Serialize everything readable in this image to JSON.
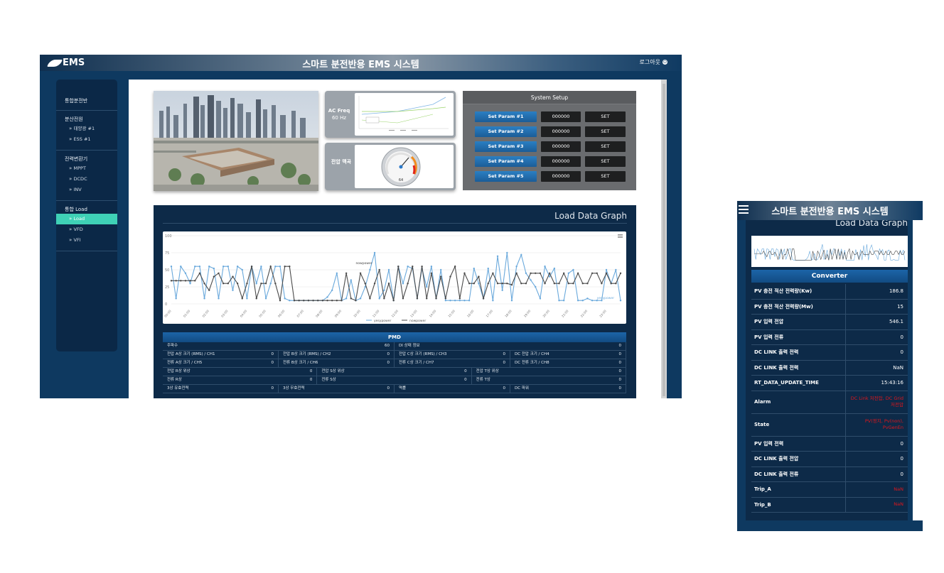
{
  "desktop": {
    "logo": "EMS",
    "title": "스마트 분전반용 EMS 시스템",
    "logout": "로그아웃",
    "sidebar": [
      {
        "head": "통합분전반",
        "items": []
      },
      {
        "head": "분산전원",
        "items": [
          "태양광 #1",
          "ESS #1"
        ]
      },
      {
        "head": "전력변환기",
        "items": [
          "MPPT",
          "DCDC",
          "INV"
        ]
      },
      {
        "head": "통합 Load",
        "items": [
          "Load",
          "VFD",
          "VFI"
        ]
      }
    ],
    "ac_freq": {
      "label": "AC Freq",
      "value": "60 Hz"
    },
    "gauge": {
      "label": "전압 맥곡",
      "value": "64"
    },
    "setup": {
      "title": "System Setup",
      "rows": [
        {
          "param": "Set Param #1",
          "value": "000000",
          "button": "SET"
        },
        {
          "param": "Set Param #2",
          "value": "000000",
          "button": "SET"
        },
        {
          "param": "Set Param #3",
          "value": "000000",
          "button": "SET"
        },
        {
          "param": "Set Param #4",
          "value": "000000",
          "button": "SET"
        },
        {
          "param": "Set Param #5",
          "value": "000000",
          "button": "SET"
        }
      ]
    },
    "graph_title": "Load Data Graph",
    "pmd": {
      "title": "PMD",
      "rows": [
        [
          [
            "주파수",
            "60"
          ],
          [
            "DI 상태 정보",
            "0"
          ]
        ],
        [
          [
            "전압 A상 크기 (RMS) / CH1",
            "0"
          ],
          [
            "전압 B상 크기 (RMS) / CH2",
            "0"
          ],
          [
            "전압 C상 크기 (RMS) / CH3",
            "0"
          ],
          [
            "DC 전압 크기 / CH4",
            "0"
          ]
        ],
        [
          [
            "전류 A상 크기 / CH5",
            "0"
          ],
          [
            "전류 B상 크기 / CH6",
            "0"
          ],
          [
            "전류 C상 크기 / CH7",
            "0"
          ],
          [
            "DC 전류 크기 / CH8",
            "0"
          ]
        ],
        [
          [
            "전압 R상 위상",
            "0"
          ],
          [
            "전압 S상 위상",
            "0"
          ],
          [
            "전압 T상 위상",
            "0"
          ]
        ],
        [
          [
            "전류 R상",
            "0"
          ],
          [
            "전류 S상",
            "0"
          ],
          [
            "전류 T상",
            "0"
          ]
        ],
        [
          [
            "3상 유효전력",
            "0"
          ],
          [
            "3상 무효전력",
            "0"
          ],
          [
            "역률",
            "0"
          ],
          [
            "DC 파워",
            "0"
          ]
        ]
      ]
    }
  },
  "chart_data": {
    "type": "line",
    "ylim": [
      0,
      100
    ],
    "yticks": [
      0,
      25,
      50,
      75,
      100
    ],
    "x": [
      "00:00",
      "00:15",
      "00:30",
      "00:45",
      "01:00",
      "01:15",
      "01:30",
      "01:45",
      "02:00",
      "02:15",
      "02:30",
      "02:45",
      "03:00",
      "03:15",
      "03:30",
      "03:45",
      "04:00",
      "04:15",
      "04:30",
      "04:45",
      "05:00",
      "05:15",
      "05:30",
      "05:45",
      "06:00",
      "06:15",
      "06:30",
      "06:45",
      "07:00",
      "07:15",
      "07:30",
      "07:45",
      "08:00",
      "08:15",
      "08:30",
      "08:45",
      "09:00",
      "09:15",
      "09:30",
      "09:45",
      "10:00",
      "10:15",
      "10:30",
      "10:45",
      "11:00",
      "11:15",
      "11:30",
      "11:45",
      "12:00",
      "12:15",
      "12:30",
      "12:45",
      "13:00",
      "13:15",
      "13:30",
      "13:45",
      "14:00",
      "14:15",
      "14:30",
      "14:45",
      "15:00",
      "15:15",
      "15:30",
      "15:45",
      "16:00",
      "16:15",
      "16:30",
      "16:45",
      "17:00",
      "17:15",
      "17:30",
      "17:45",
      "18:00",
      "18:15",
      "18:30",
      "18:45",
      "19:00",
      "19:15",
      "19:30",
      "19:45",
      "20:00",
      "20:15",
      "20:30",
      "20:45",
      "21:00",
      "21:15",
      "21:30",
      "21:45",
      "22:00",
      "22:15",
      "22:30",
      "22:45",
      "23:00",
      "23:15",
      "23:30",
      "23:45"
    ],
    "xticks_every": 4,
    "series": [
      {
        "name": "yesypower",
        "color": "#6aa9dc",
        "values": [
          55,
          8,
          55,
          45,
          30,
          55,
          55,
          8,
          55,
          52,
          8,
          55,
          55,
          20,
          55,
          50,
          8,
          55,
          30,
          55,
          8,
          30,
          55,
          55,
          8,
          5,
          5,
          5,
          5,
          5,
          5,
          5,
          5,
          10,
          20,
          45,
          5,
          8,
          35,
          5,
          8,
          25,
          50,
          75,
          8,
          20,
          50,
          5,
          55,
          30,
          55,
          52,
          8,
          52,
          25,
          55,
          8,
          50,
          5,
          5,
          5,
          5,
          5,
          5,
          52,
          30,
          8,
          52,
          5,
          70,
          20,
          75,
          5,
          55,
          72,
          45,
          35,
          25,
          8,
          55,
          40,
          52,
          5,
          5,
          45,
          50,
          5,
          5,
          8,
          5,
          5,
          5,
          50,
          30,
          50,
          5
        ]
      },
      {
        "name": "nowpower",
        "color": "#4a4a4a",
        "values": [
          34,
          34,
          34,
          34,
          34,
          34,
          45,
          30,
          20,
          40,
          45,
          30,
          30,
          40,
          30,
          8,
          30,
          55,
          8,
          30,
          30,
          55,
          30,
          5,
          55,
          55,
          5,
          5,
          5,
          5,
          5,
          5,
          5,
          5,
          5,
          5,
          5,
          45,
          8,
          5,
          45,
          30,
          8,
          30,
          50,
          8,
          30,
          5,
          55,
          8,
          30,
          55,
          8,
          55,
          8,
          45,
          8,
          40,
          8,
          40,
          55,
          8,
          45,
          30,
          30,
          40,
          8,
          30,
          45,
          30,
          30,
          30,
          28,
          45,
          30,
          30,
          45,
          45,
          45,
          30,
          45,
          30,
          30,
          45,
          30,
          30,
          45,
          30,
          30,
          45,
          45,
          30,
          45,
          30,
          30,
          45
        ]
      }
    ]
  },
  "mobile": {
    "title": "스마트 분전반용 EMS 시스템",
    "graph_title": "Load Data Graph",
    "converter_title": "Converter",
    "rows": [
      {
        "label": "PV 충전 적산 전력량(Kw)",
        "value": "186.8"
      },
      {
        "label": "PV 충전 적산 전력량(Mw)",
        "value": "15"
      },
      {
        "label": "PV 입력 전압",
        "value": "546.1"
      },
      {
        "label": "PV 입력 전류",
        "value": "0"
      },
      {
        "label": "DC LINK 출력 전력",
        "value": "0"
      },
      {
        "label": "DC LINK 출력 전력",
        "value": "NaN"
      },
      {
        "label": "RT_DATA_UPDATE_TIME",
        "value": "15:43:16"
      },
      {
        "label": "Alarm",
        "value": "DC Link 저전압, DC Grid 저전압",
        "red": true
      },
      {
        "label": "State",
        "value": "PV(정지, Pv(non), PvGenEn",
        "red": true
      },
      {
        "label": "PV 입력 전력",
        "value": "0"
      },
      {
        "label": "DC LINK 출력 전압",
        "value": "0"
      },
      {
        "label": "DC LINK 출력 전류",
        "value": "0"
      },
      {
        "label": "Trip_A",
        "value": "NaN",
        "red": true
      },
      {
        "label": "Trip_B",
        "value": "NaN",
        "red": true
      }
    ]
  }
}
